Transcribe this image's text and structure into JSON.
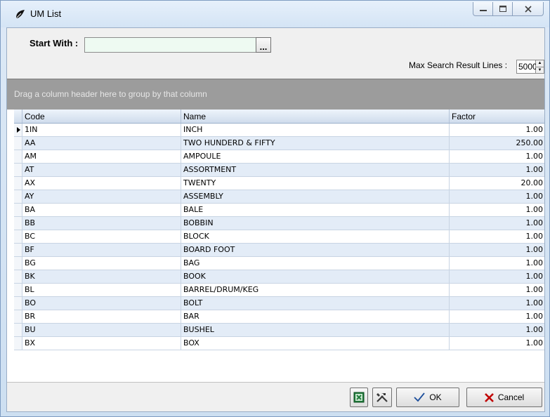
{
  "window": {
    "title": "UM List",
    "controls": [
      "minimize",
      "maximize",
      "close"
    ]
  },
  "filter": {
    "start_with_label": "Start With :",
    "start_with_value": "",
    "ellipsis_label": "...",
    "max_lines_label": "Max Search Result Lines :",
    "max_lines_value": "5000"
  },
  "grid": {
    "group_hint": "Drag a column header here to group by that column",
    "columns": [
      "Code",
      "Name",
      "Factor"
    ],
    "rows": [
      {
        "code": "1IN",
        "name": "INCH",
        "factor": "1.00"
      },
      {
        "code": "AA",
        "name": "TWO HUNDERD & FIFTY",
        "factor": "250.00"
      },
      {
        "code": "AM",
        "name": "AMPOULE",
        "factor": "1.00"
      },
      {
        "code": "AT",
        "name": "ASSORTMENT",
        "factor": "1.00"
      },
      {
        "code": "AX",
        "name": "TWENTY",
        "factor": "20.00"
      },
      {
        "code": "AY",
        "name": "ASSEMBLY",
        "factor": "1.00"
      },
      {
        "code": "BA",
        "name": "BALE",
        "factor": "1.00"
      },
      {
        "code": "BB",
        "name": "BOBBIN",
        "factor": "1.00"
      },
      {
        "code": "BC",
        "name": "BLOCK",
        "factor": "1.00"
      },
      {
        "code": "BF",
        "name": "BOARD FOOT",
        "factor": "1.00"
      },
      {
        "code": "BG",
        "name": "BAG",
        "factor": "1.00"
      },
      {
        "code": "BK",
        "name": "BOOK",
        "factor": "1.00"
      },
      {
        "code": "BL",
        "name": "BARREL/DRUM/KEG",
        "factor": "1.00"
      },
      {
        "code": "BO",
        "name": "BOLT",
        "factor": "1.00"
      },
      {
        "code": "BR",
        "name": "BAR",
        "factor": "1.00"
      },
      {
        "code": "BU",
        "name": "BUSHEL",
        "factor": "1.00"
      },
      {
        "code": "BX",
        "name": "BOX",
        "factor": "1.00"
      }
    ],
    "selected_row": 0
  },
  "footer": {
    "ok_label": "OK",
    "cancel_label": "Cancel"
  },
  "icons": {
    "title": "app-window-icon",
    "excel": "excel-export-icon",
    "tools": "tools-icon",
    "ok": "checkmark-icon",
    "cancel": "x-icon"
  },
  "colors": {
    "input_bg": "#eefaf2",
    "alt_row": "#e3ecf7",
    "group_panel": "#9c9c9c",
    "cancel_x": "#c00000",
    "ok_check": "#1d4f9c"
  }
}
